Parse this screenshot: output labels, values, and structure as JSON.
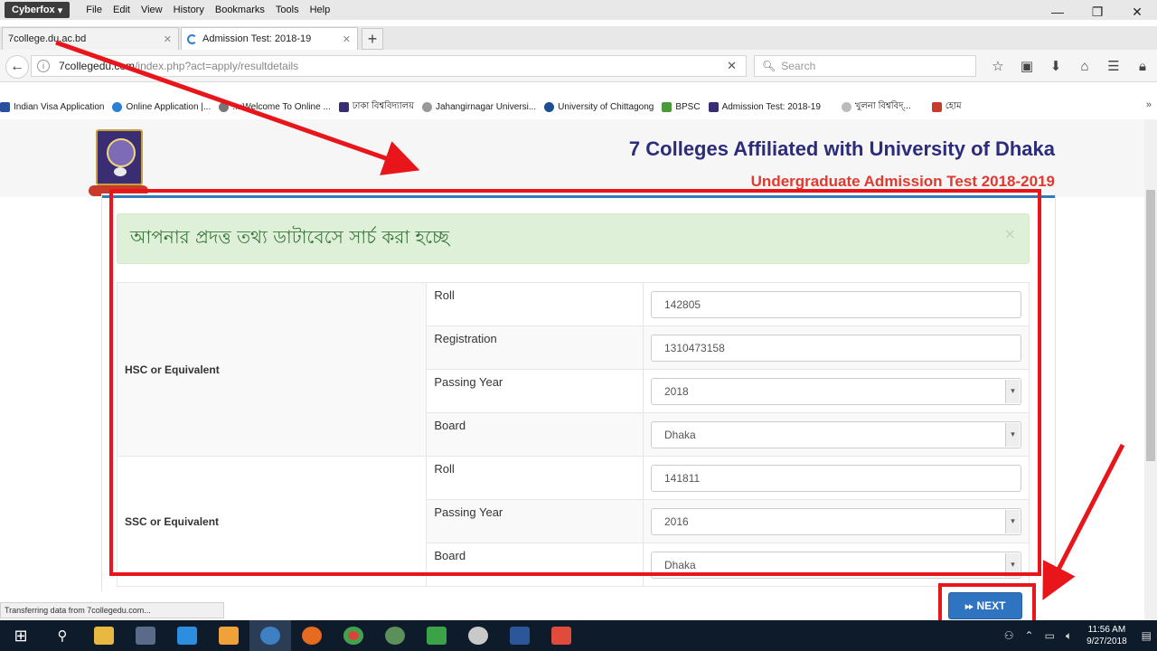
{
  "browser": {
    "app_button": "Cyberfox",
    "menu": [
      "File",
      "Edit",
      "View",
      "History",
      "Bookmarks",
      "Tools",
      "Help"
    ],
    "tabs": [
      {
        "title": "7college.du.ac.bd",
        "active": false
      },
      {
        "title": "Admission Test: 2018-19",
        "active": true
      }
    ],
    "url_host": "7collegedu.com",
    "url_path": "/index.php?act=apply/resultdetails",
    "search_placeholder": "Search",
    "bookmarks": [
      {
        "label": "Indian Visa Application",
        "color": "#2a4fa0"
      },
      {
        "label": "Online Application |...",
        "color": "#2a7fd4"
      },
      {
        "label": "..::Welcome To Online ...",
        "color": "#777777"
      },
      {
        "label": "ঢাকা বিশ্ববিদ্যালয়",
        "color": "#3b2d74"
      },
      {
        "label": "Jahangirnagar Universi...",
        "color": "#999999"
      },
      {
        "label": "University of Chittagong",
        "color": "#1d4f91"
      },
      {
        "label": "BPSC",
        "color": "#4a9a3b"
      },
      {
        "label": "Admission Test: 2018-19",
        "color": "#3b2d74"
      },
      {
        "label": "খুলনা বিশ্ববিদ্...",
        "color": "#bbbbbb"
      },
      {
        "label": "হোম",
        "color": "#c83b2b"
      }
    ],
    "status_text": "Transferring data from 7collegedu.com..."
  },
  "page": {
    "title": "7 Colleges Affiliated with University of Dhaka",
    "subtitle": "Undergraduate Admission Test 2018-2019",
    "alert": "আপনার প্রদত্ত তথ্য ডাটাবেসে সার্চ করা হচ্ছে",
    "hsc": {
      "group_label": "HSC or Equivalent",
      "roll_label": "Roll",
      "roll_value": "142805",
      "registration_label": "Registration",
      "registration_value": "1310473158",
      "passing_year_label": "Passing Year",
      "passing_year_value": "2018",
      "board_label": "Board",
      "board_value": "Dhaka"
    },
    "ssc": {
      "group_label": "SSC or Equivalent",
      "roll_label": "Roll",
      "roll_value": "141811",
      "passing_year_label": "Passing Year",
      "passing_year_value": "2016",
      "board_label": "Board",
      "board_value": "Dhaka"
    },
    "next_button": "NEXT"
  },
  "taskbar": {
    "time": "11:56 AM",
    "date": "9/27/2018"
  },
  "colors": {
    "annotation_red": "#e8151b",
    "title_navy": "#2c2c7a",
    "subtitle_red": "#e03a2f",
    "alert_green_bg": "#dff0d8",
    "next_blue": "#2e74c0"
  }
}
